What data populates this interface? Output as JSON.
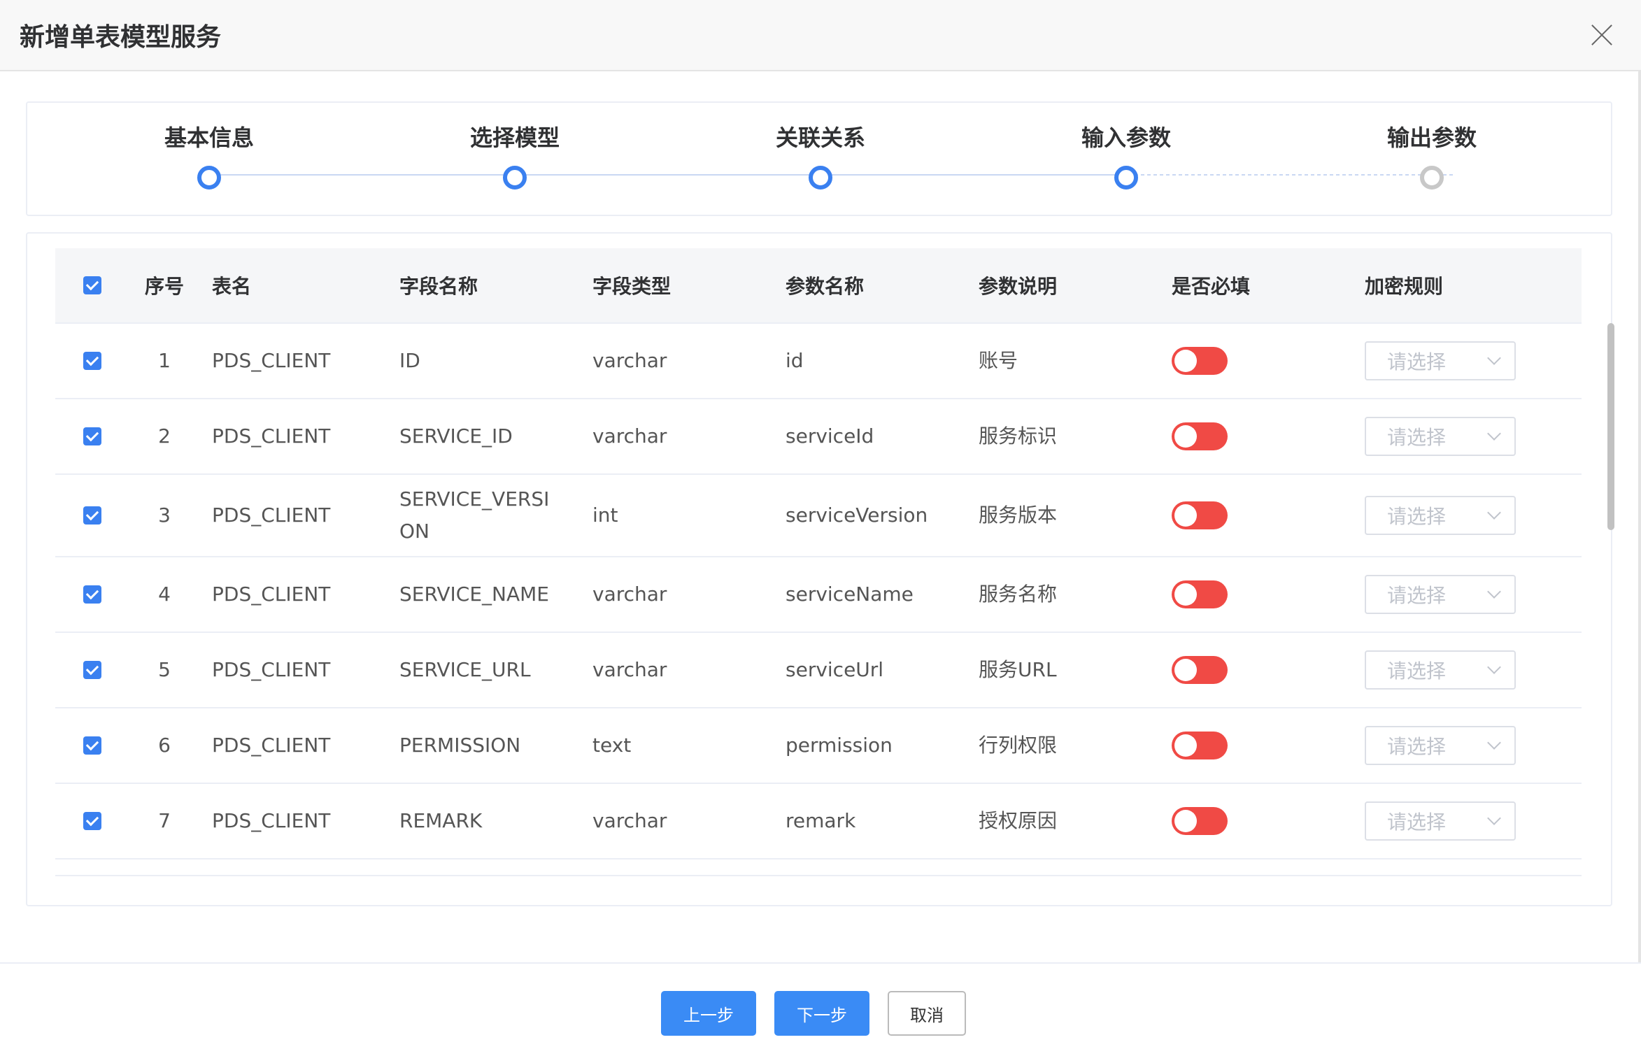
{
  "dialog": {
    "title": "新增单表模型服务"
  },
  "steps": [
    {
      "label": "基本信息",
      "status": "done"
    },
    {
      "label": "选择模型",
      "status": "done"
    },
    {
      "label": "关联关系",
      "status": "done"
    },
    {
      "label": "输入参数",
      "status": "current"
    },
    {
      "label": "输出参数",
      "status": "pending"
    }
  ],
  "table": {
    "headers": {
      "no": "序号",
      "table_name": "表名",
      "field_name": "字段名称",
      "field_type": "字段类型",
      "param_name": "参数名称",
      "param_desc": "参数说明",
      "required": "是否必填",
      "encryption": "加密规则"
    },
    "rows": [
      {
        "no": "1",
        "table_name": "PDS_CLIENT",
        "field_name": "ID",
        "field_type": "varchar",
        "param_name": "id",
        "param_desc": "账号",
        "select": "请选择"
      },
      {
        "no": "2",
        "table_name": "PDS_CLIENT",
        "field_name": "SERVICE_ID",
        "field_type": "varchar",
        "param_name": "serviceId",
        "param_desc": "服务标识",
        "select": "请选择"
      },
      {
        "no": "3",
        "table_name": "PDS_CLIENT",
        "field_name": "SERVICE_VERSI ON",
        "field_type": "int",
        "param_name": "serviceVersion",
        "param_desc": "服务版本",
        "select": "请选择"
      },
      {
        "no": "4",
        "table_name": "PDS_CLIENT",
        "field_name": "SERVICE_NAME",
        "field_type": "varchar",
        "param_name": "serviceName",
        "param_desc": "服务名称",
        "select": "请选择"
      },
      {
        "no": "5",
        "table_name": "PDS_CLIENT",
        "field_name": "SERVICE_URL",
        "field_type": "varchar",
        "param_name": "serviceUrl",
        "param_desc": "服务URL",
        "select": "请选择"
      },
      {
        "no": "6",
        "table_name": "PDS_CLIENT",
        "field_name": "PERMISSION",
        "field_type": "text",
        "param_name": "permission",
        "param_desc": "行列权限",
        "select": "请选择"
      },
      {
        "no": "7",
        "table_name": "PDS_CLIENT",
        "field_name": "REMARK",
        "field_type": "varchar",
        "param_name": "remark",
        "param_desc": "授权原因",
        "select": "请选择"
      }
    ]
  },
  "footer": {
    "prev_label": "上一步",
    "next_label": "下一步",
    "cancel_label": "取消"
  },
  "colors": {
    "accent": "#3a80f0",
    "toggle_off": "#f04a45",
    "button_primary": "#3a8bf5"
  }
}
